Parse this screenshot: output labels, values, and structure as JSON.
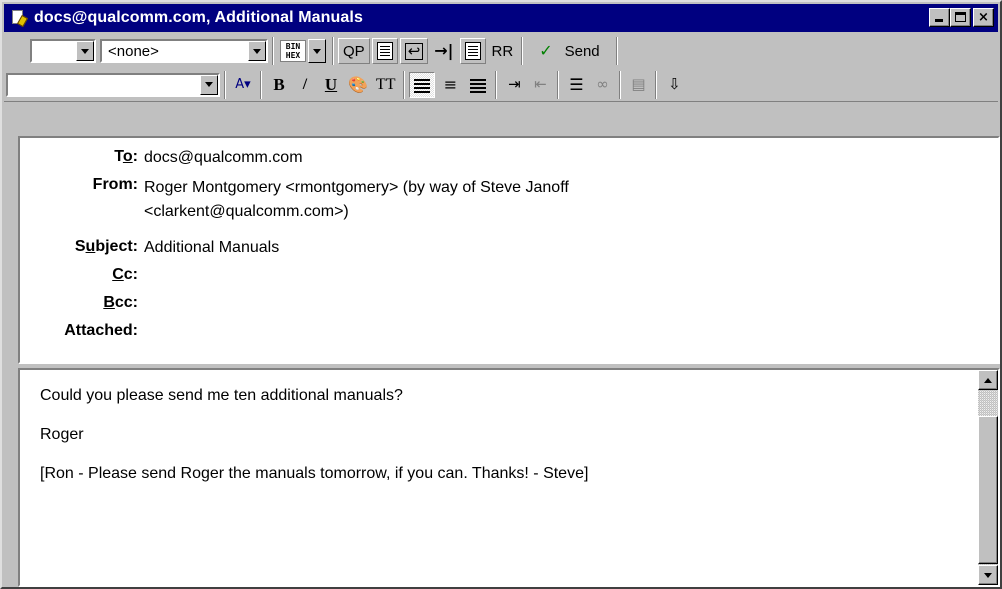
{
  "window": {
    "title": "docs@qualcomm.com, Additional Manuals",
    "controls": {
      "minimize_icon": "minimize-icon",
      "maximize_icon": "maximize-icon",
      "close_glyph": "×"
    }
  },
  "toolbar1": {
    "priority_value": "",
    "signature_value": "<none>",
    "binhex_top": "BIN",
    "binhex_bottom": "HEX",
    "qp_label": "QP",
    "rr_label": "RR",
    "send_label": "Send"
  },
  "toolbar2": {
    "font_value": "",
    "bold_glyph": "B",
    "italic_glyph": "/",
    "underline_glyph": "U",
    "teletype_label": "TT"
  },
  "headers": {
    "to_label": "To:",
    "to_value": "docs@qualcomm.com",
    "from_label": "From:",
    "from_value_line1": "Roger Montgomery <rmontgomery> (by way of Steve Janoff",
    "from_value_line2": "<clarkent@qualcomm.com>)",
    "subject_label": "Subject:",
    "subject_value": "Additional Manuals",
    "cc_label": "Cc:",
    "cc_value": "",
    "bcc_label": "Bcc:",
    "bcc_value": "",
    "attached_label": "Attached:",
    "attached_value": ""
  },
  "body": {
    "line1": "Could you please send me ten additional manuals?",
    "line2": "Roger",
    "line3": "[Ron - Please send Roger the manuals tomorrow, if you can. Thanks! - Steve]"
  },
  "colors": {
    "titlebar": "#000080",
    "face": "#c0c0c0"
  }
}
